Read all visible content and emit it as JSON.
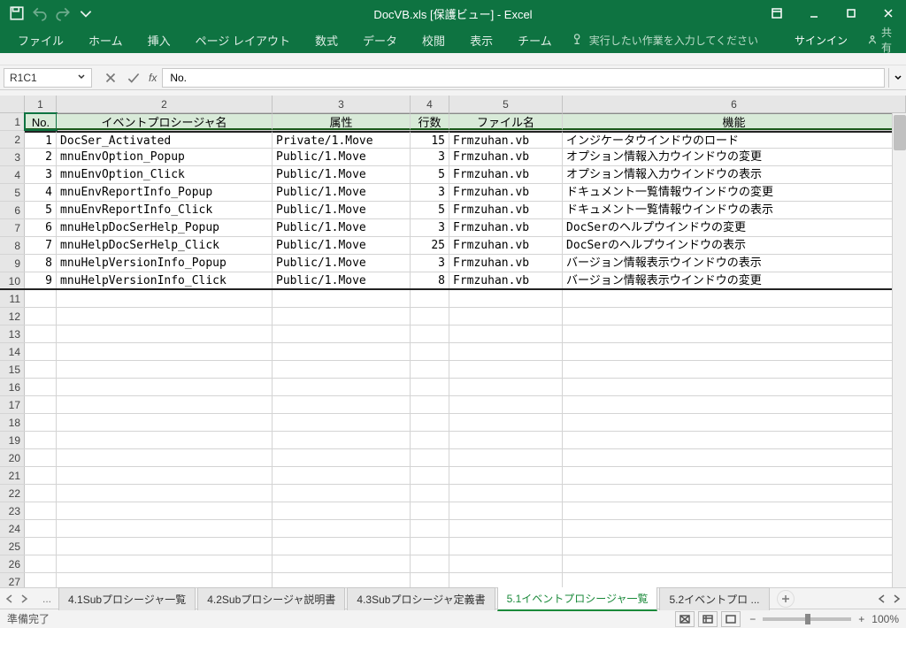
{
  "titlebar": {
    "title": "DocVB.xls [保護ビュー] - Excel"
  },
  "ribbon": {
    "tabs": [
      "ファイル",
      "ホーム",
      "挿入",
      "ページ レイアウト",
      "数式",
      "データ",
      "校閲",
      "表示",
      "チーム"
    ],
    "tell": "実行したい作業を入力してください",
    "signin": "サインイン",
    "share": "共有"
  },
  "namebox": "R1C1",
  "formula": "No.",
  "columns": [
    "1",
    "2",
    "3",
    "4",
    "5",
    "6"
  ],
  "headers": {
    "no": "No.",
    "name": "イベントプロシージャ名",
    "attr": "属性",
    "lines": "行数",
    "file": "ファイル名",
    "func": "機能"
  },
  "rows": [
    {
      "r": "2",
      "no": "1",
      "name": "DocSer_Activated",
      "attr": "Private/1.Move",
      "lines": "15",
      "file": "Frmzuhan.vb",
      "func": "インジケータウインドウのロード"
    },
    {
      "r": "3",
      "no": "2",
      "name": "mnuEnvOption_Popup",
      "attr": "Public/1.Move",
      "lines": "3",
      "file": "Frmzuhan.vb",
      "func": "オプション情報入力ウインドウの変更"
    },
    {
      "r": "4",
      "no": "3",
      "name": "mnuEnvOption_Click",
      "attr": "Public/1.Move",
      "lines": "5",
      "file": "Frmzuhan.vb",
      "func": "オプション情報入力ウインドウの表示"
    },
    {
      "r": "5",
      "no": "4",
      "name": "mnuEnvReportInfo_Popup",
      "attr": "Public/1.Move",
      "lines": "3",
      "file": "Frmzuhan.vb",
      "func": "ドキュメント一覧情報ウインドウの変更"
    },
    {
      "r": "6",
      "no": "5",
      "name": "mnuEnvReportInfo_Click",
      "attr": "Public/1.Move",
      "lines": "5",
      "file": "Frmzuhan.vb",
      "func": "ドキュメント一覧情報ウインドウの表示"
    },
    {
      "r": "7",
      "no": "6",
      "name": "mnuHelpDocSerHelp_Popup",
      "attr": "Public/1.Move",
      "lines": "3",
      "file": "Frmzuhan.vb",
      "func": "DocSerのヘルプウインドウの変更"
    },
    {
      "r": "8",
      "no": "7",
      "name": "mnuHelpDocSerHelp_Click",
      "attr": "Public/1.Move",
      "lines": "25",
      "file": "Frmzuhan.vb",
      "func": "DocSerのヘルプウインドウの表示"
    },
    {
      "r": "9",
      "no": "8",
      "name": "mnuHelpVersionInfo_Popup",
      "attr": "Public/1.Move",
      "lines": "3",
      "file": "Frmzuhan.vb",
      "func": "バージョン情報表示ウインドウの表示"
    },
    {
      "r": "10",
      "no": "9",
      "name": "mnuHelpVersionInfo_Click",
      "attr": "Public/1.Move",
      "lines": "8",
      "file": "Frmzuhan.vb",
      "func": "バージョン情報表示ウインドウの変更"
    }
  ],
  "blankrows": [
    "11",
    "12",
    "13",
    "14",
    "15",
    "16",
    "17",
    "18",
    "19",
    "20",
    "21",
    "22",
    "23",
    "24",
    "25",
    "26",
    "27"
  ],
  "sheets": [
    "4.1Subプロシージャ一覧",
    "4.2Subプロシージャ説明書",
    "4.3Subプロシージャ定義書",
    "5.1イベントプロシージャ一覧",
    "5.2イベントプロ ..."
  ],
  "sheets_dots": "...",
  "status": {
    "ready": "準備完了",
    "zoom": "100%"
  }
}
